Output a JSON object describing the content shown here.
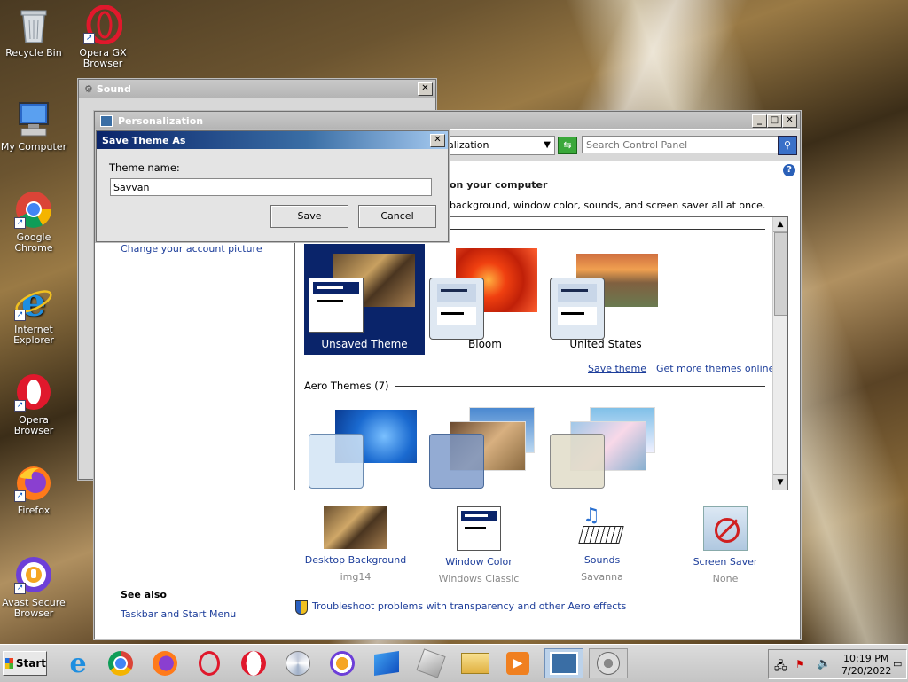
{
  "desktop_icons": [
    {
      "label": "Recycle Bin",
      "icon": "recycle-bin-icon"
    },
    {
      "label": "Opera GX Browser",
      "icon": "opera-gx-icon"
    },
    {
      "label": "My Computer",
      "icon": "my-computer-icon"
    },
    {
      "label": "Google Chrome",
      "icon": "chrome-icon"
    },
    {
      "label": "Internet Explorer",
      "icon": "internet-explorer-icon"
    },
    {
      "label": "Opera Browser",
      "icon": "opera-icon"
    },
    {
      "label": "Firefox",
      "icon": "firefox-icon"
    },
    {
      "label": "Avast Secure Browser",
      "icon": "avast-browser-icon"
    }
  ],
  "sound_window": {
    "title": "Sound"
  },
  "personalization": {
    "title": "Personalization",
    "address_text": "alization",
    "search_placeholder": "Search Control Panel",
    "heading": "on your computer",
    "subheading": "background, window color, sounds, and screen saver all at once.",
    "sidebar_link": "Change your account picture",
    "my_themes": [
      {
        "name": "Unsaved Theme",
        "selected": true
      },
      {
        "name": "Bloom",
        "selected": false
      },
      {
        "name": "United States",
        "selected": false
      }
    ],
    "save_theme": "Save theme",
    "get_more": "Get more themes online",
    "aero_header": "Aero Themes (7)",
    "bottom_items": [
      {
        "label": "Desktop Background",
        "sub": "img14",
        "icon": "desktop-background-icon"
      },
      {
        "label": "Window Color",
        "sub": "Windows Classic",
        "icon": "window-color-icon"
      },
      {
        "label": "Sounds",
        "sub": "Savanna",
        "icon": "sounds-icon"
      },
      {
        "label": "Screen Saver",
        "sub": "None",
        "icon": "screen-saver-icon"
      }
    ],
    "see_also": "See also",
    "see_also_link": "Taskbar and Start Menu",
    "troubleshoot": "Troubleshoot problems with transparency and other Aero effects"
  },
  "save_dialog": {
    "title": "Save Theme As",
    "field_label": "Theme name:",
    "field_value": "Savvan",
    "save": "Save",
    "cancel": "Cancel"
  },
  "taskbar": {
    "start": "Start",
    "time": "10:19 PM",
    "date": "7/20/2022"
  }
}
